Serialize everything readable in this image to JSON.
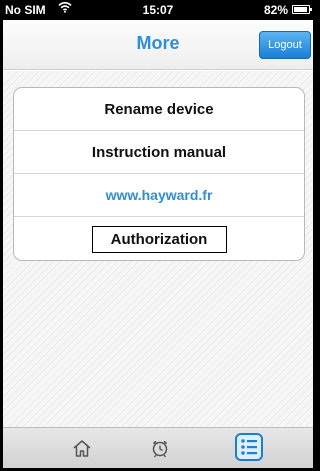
{
  "status_bar": {
    "carrier": "No SIM",
    "time": "15:07",
    "battery": "82%",
    "wifi_icon": "wifi-icon",
    "battery_icon": "battery-icon"
  },
  "nav": {
    "title": "More",
    "logout_label": "Logout"
  },
  "menu": {
    "rename": "Rename device",
    "manual": "Instruction manual",
    "website": "www.hayward.fr",
    "authorization": "Authorization"
  },
  "tabs": [
    {
      "icon": "home-icon"
    },
    {
      "icon": "alarm-clock-icon"
    },
    {
      "icon": "list-icon",
      "selected": true
    }
  ],
  "colors": {
    "accent": "#2f8ed6",
    "logout_button": "#1a7fd4"
  }
}
